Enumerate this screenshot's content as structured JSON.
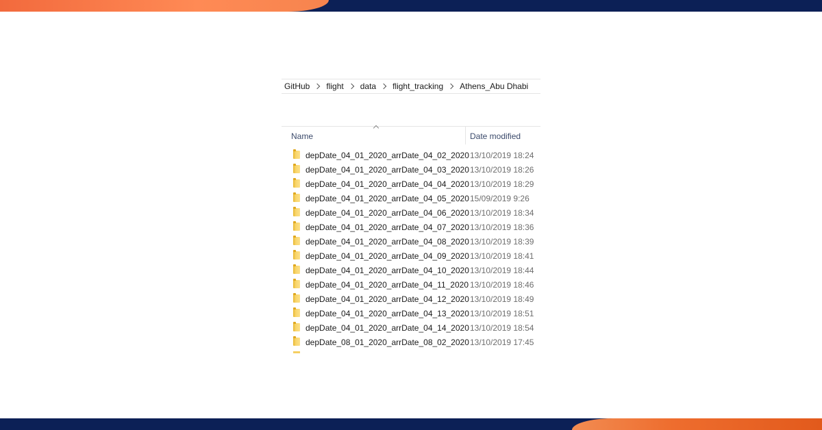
{
  "colors": {
    "navy": "#0c2056",
    "orange": "#f26a3d",
    "folder": "#f5cf62"
  },
  "breadcrumb": [
    "GitHub",
    "flight",
    "data",
    "flight_tracking",
    "Athens_Abu Dhabi"
  ],
  "columns": {
    "name": "Name",
    "date_modified": "Date modified"
  },
  "files": [
    {
      "name": "depDate_04_01_2020_arrDate_04_02_2020",
      "date": "13/10/2019 18:24"
    },
    {
      "name": "depDate_04_01_2020_arrDate_04_03_2020",
      "date": "13/10/2019 18:26"
    },
    {
      "name": "depDate_04_01_2020_arrDate_04_04_2020",
      "date": "13/10/2019 18:29"
    },
    {
      "name": "depDate_04_01_2020_arrDate_04_05_2020",
      "date": "15/09/2019 9:26"
    },
    {
      "name": "depDate_04_01_2020_arrDate_04_06_2020",
      "date": "13/10/2019 18:34"
    },
    {
      "name": "depDate_04_01_2020_arrDate_04_07_2020",
      "date": "13/10/2019 18:36"
    },
    {
      "name": "depDate_04_01_2020_arrDate_04_08_2020",
      "date": "13/10/2019 18:39"
    },
    {
      "name": "depDate_04_01_2020_arrDate_04_09_2020",
      "date": "13/10/2019 18:41"
    },
    {
      "name": "depDate_04_01_2020_arrDate_04_10_2020",
      "date": "13/10/2019 18:44"
    },
    {
      "name": "depDate_04_01_2020_arrDate_04_11_2020",
      "date": "13/10/2019 18:46"
    },
    {
      "name": "depDate_04_01_2020_arrDate_04_12_2020",
      "date": "13/10/2019 18:49"
    },
    {
      "name": "depDate_04_01_2020_arrDate_04_13_2020",
      "date": "13/10/2019 18:51"
    },
    {
      "name": "depDate_04_01_2020_arrDate_04_14_2020",
      "date": "13/10/2019 18:54"
    },
    {
      "name": "depDate_08_01_2020_arrDate_08_02_2020",
      "date": "13/10/2019 17:45"
    }
  ]
}
